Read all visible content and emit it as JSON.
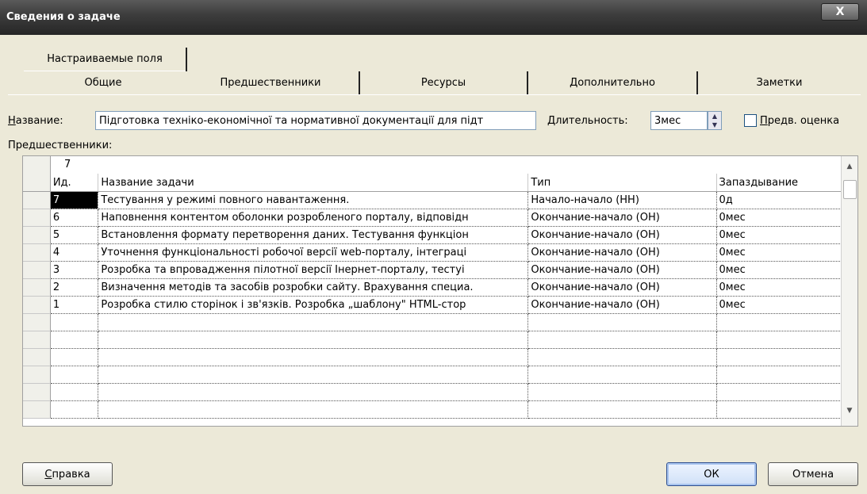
{
  "window": {
    "title": "Сведения о задаче",
    "close_label": "X"
  },
  "tabs": {
    "row1": [
      {
        "label": "Настраиваемые поля"
      }
    ],
    "row2": [
      {
        "label": "Общие"
      },
      {
        "label": "Предшественники"
      },
      {
        "label": "Ресурсы"
      },
      {
        "label": "Дополнительно"
      },
      {
        "label": "Заметки"
      }
    ],
    "active": "Предшественники"
  },
  "name": {
    "label_prefix": "Н",
    "label_rest": "азвание:",
    "value": "Підготовка техніко-економічної та нормативної документації для підт"
  },
  "duration": {
    "label_prefix": "Д",
    "label_rest": "лительность:",
    "value": "3мес"
  },
  "estimate": {
    "label_prefix": "П",
    "label_rest": "редв. оценка",
    "checked": false
  },
  "predecessors_label": {
    "prefix": "Пре",
    "mnemonic": "д",
    "rest": "шественники:"
  },
  "grid": {
    "edit_value": "7",
    "columns": [
      "Ид.",
      "Название задачи",
      "Тип",
      "Запаздывание"
    ],
    "rows": [
      {
        "id": "7",
        "name": "Тестування у режимі повного навантаження.",
        "type": "Начало-начало (НН)",
        "lag": "0д"
      },
      {
        "id": "6",
        "name": "Наповнення контентом оболонки розробленого порталу, відповідн",
        "type": "Окончание-начало (ОН)",
        "lag": "0мес"
      },
      {
        "id": "5",
        "name": "Встановлення формату перетворення даних. Тестування функціон",
        "type": "Окончание-начало (ОН)",
        "lag": "0мес"
      },
      {
        "id": "4",
        "name": "Уточнення функціональності робочої версії web-порталу, інтеграці",
        "type": "Окончание-начало (ОН)",
        "lag": "0мес"
      },
      {
        "id": "3",
        "name": "Розробка та впровадження пілотної версії Інернет-порталу, тестуі",
        "type": "Окончание-начало (ОН)",
        "lag": "0мес"
      },
      {
        "id": "2",
        "name": "Визначення методів та засобів розробки сайту. Врахування специа.",
        "type": "Окончание-начало (ОН)",
        "lag": "0мес"
      },
      {
        "id": "1",
        "name": "Розробка стилю сторінок і зв'язків. Розробка „шаблону\" HTML-стор",
        "type": "Окончание-начало (ОН)",
        "lag": "0мес"
      }
    ]
  },
  "buttons": {
    "help_prefix": "С",
    "help_rest": "правка",
    "ok": "ОК",
    "cancel": "Отмена"
  }
}
